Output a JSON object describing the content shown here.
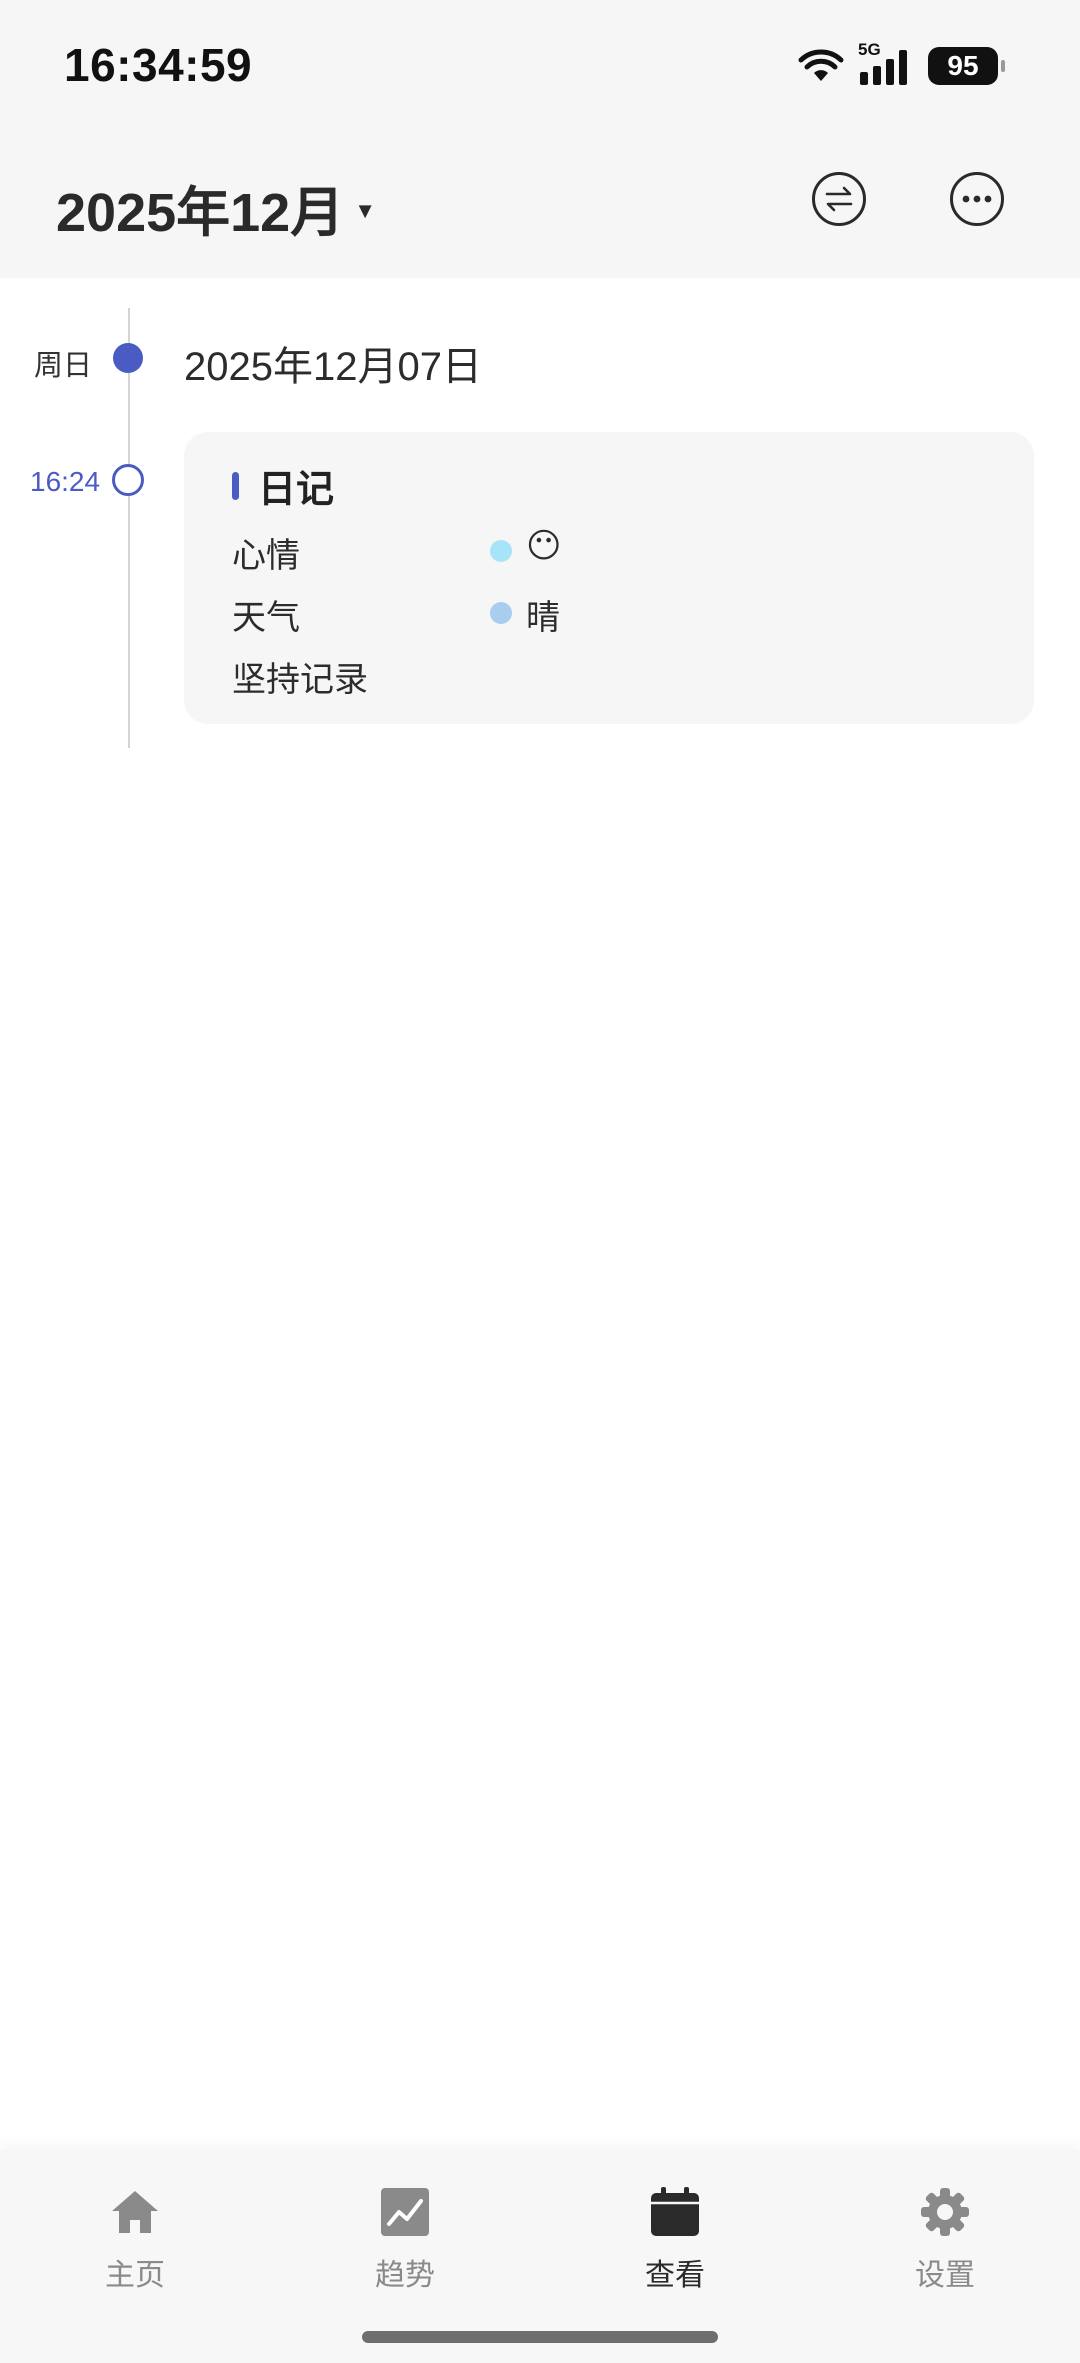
{
  "status_bar": {
    "time": "16:34:59",
    "network": "5G",
    "battery": "95"
  },
  "header": {
    "month_title": "2025年12月",
    "switch_icon": "swap-arrows-icon",
    "more_icon": "more-dots-icon"
  },
  "timeline": {
    "weekday": "周日",
    "date": "2025年12月07日",
    "entries": [
      {
        "time": "16:24",
        "title": "日记",
        "fields": [
          {
            "label": "心情",
            "value": "😶",
            "dot_color": "#a8e4f7"
          },
          {
            "label": "天气",
            "value": "晴",
            "dot_color": "#a9cdee"
          },
          {
            "label": "坚持记录",
            "value": ""
          }
        ]
      }
    ]
  },
  "colors": {
    "accent": "#4a5bc4",
    "inactive_icon": "#8a8a8a",
    "active_icon": "#2a2a2a"
  },
  "tabbar": {
    "tabs": [
      {
        "label": "主页",
        "icon": "home-icon",
        "active": false
      },
      {
        "label": "趋势",
        "icon": "trend-icon",
        "active": false
      },
      {
        "label": "查看",
        "icon": "calendar-icon",
        "active": true
      },
      {
        "label": "设置",
        "icon": "gear-icon",
        "active": false
      }
    ]
  }
}
